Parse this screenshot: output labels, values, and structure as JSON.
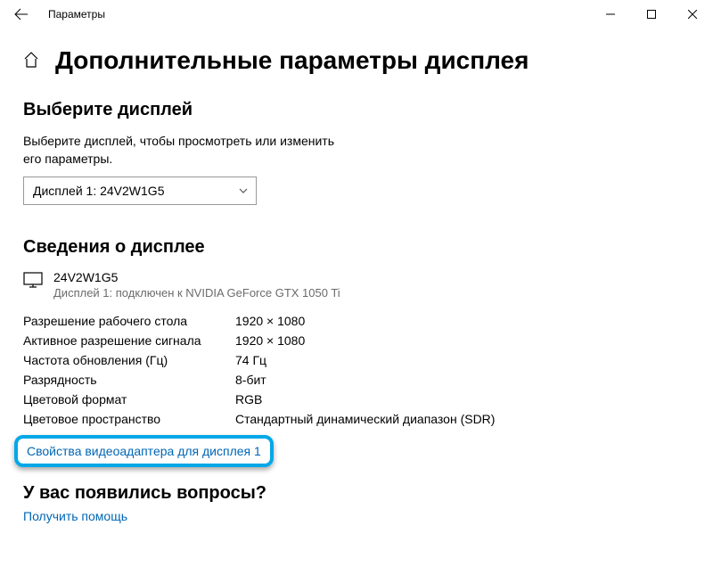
{
  "window": {
    "title": "Параметры"
  },
  "page": {
    "title": "Дополнительные параметры дисплея"
  },
  "selectDisplay": {
    "heading": "Выберите дисплей",
    "helper": "Выберите дисплей, чтобы просмотреть или изменить его параметры.",
    "dropdown": "Дисплей 1: 24V2W1G5"
  },
  "displayInfo": {
    "heading": "Сведения о дисплее",
    "name": "24V2W1G5",
    "sub": "Дисплей 1: подключен к NVIDIA GeForce GTX 1050 Ti",
    "specs": [
      {
        "label": "Разрешение рабочего стола",
        "value": "1920 × 1080"
      },
      {
        "label": "Активное разрешение сигнала",
        "value": "1920 × 1080"
      },
      {
        "label": "Частота обновления (Гц)",
        "value": "74 Гц"
      },
      {
        "label": "Разрядность",
        "value": "8-бит"
      },
      {
        "label": "Цветовой формат",
        "value": "RGB"
      },
      {
        "label": "Цветовое пространство",
        "value": "Стандартный динамический диапазон (SDR)"
      }
    ],
    "adapterLink": "Свойства видеоадаптера для дисплея 1"
  },
  "questions": {
    "heading": "У вас появились вопросы?",
    "link": "Получить помощь"
  }
}
